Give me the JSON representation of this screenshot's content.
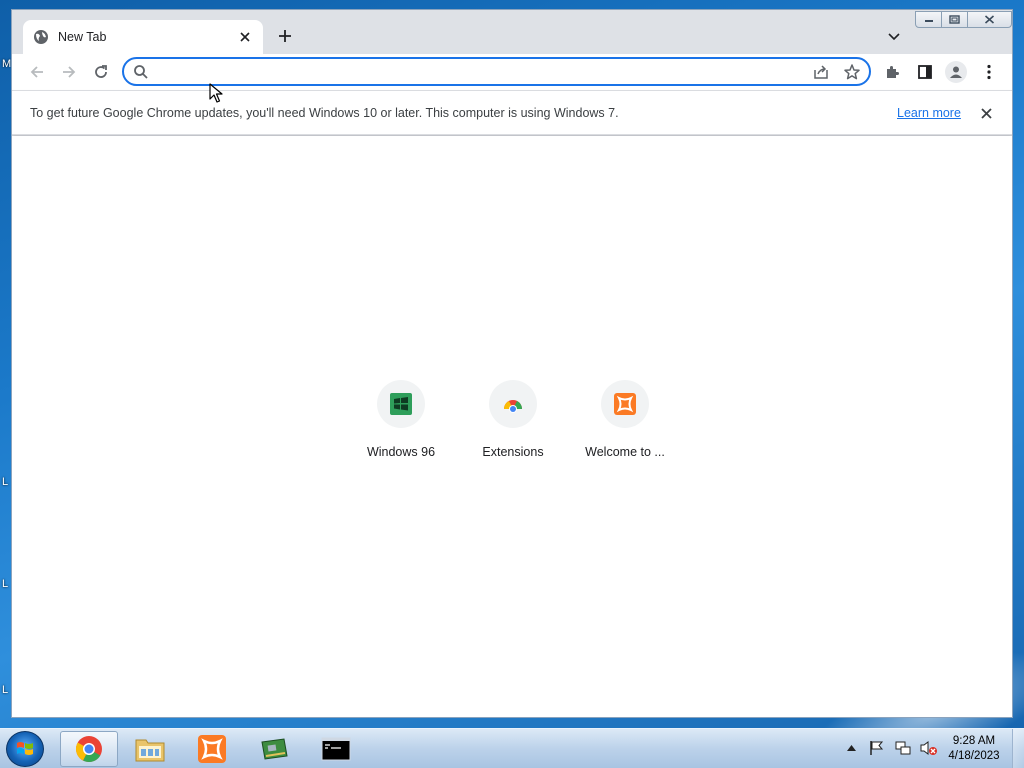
{
  "browser": {
    "tab": {
      "title": "New Tab"
    },
    "omnibox": {
      "value": "",
      "placeholder": ""
    },
    "infobar": {
      "message": "To get future Google Chrome updates, you'll need Windows 10 or later. This computer is using Windows 7.",
      "link": "Learn more"
    },
    "shortcuts": [
      {
        "label": "Windows 96",
        "icon": "windows96-icon"
      },
      {
        "label": "Extensions",
        "icon": "chrome-extensions-icon"
      },
      {
        "label": "Welcome to ...",
        "icon": "xampp-icon"
      }
    ]
  },
  "desktop": {
    "edge_letters": [
      "M",
      "L",
      "L",
      "L"
    ]
  },
  "taskbar": {
    "items": [
      {
        "name": "chrome",
        "icon": "chrome-icon",
        "active": true
      },
      {
        "name": "file-explorer",
        "icon": "folder-icon",
        "active": false
      },
      {
        "name": "xampp",
        "icon": "xampp-icon",
        "active": false
      },
      {
        "name": "network-app",
        "icon": "network-card-icon",
        "active": false
      },
      {
        "name": "command-prompt",
        "icon": "cmd-icon",
        "active": false
      }
    ],
    "clock": {
      "time": "9:28 AM",
      "date": "4/18/2023"
    }
  },
  "colors": {
    "accent": "#1a73e8",
    "xampp": "#fb7a24",
    "win96_green": "#2e9e5a"
  }
}
